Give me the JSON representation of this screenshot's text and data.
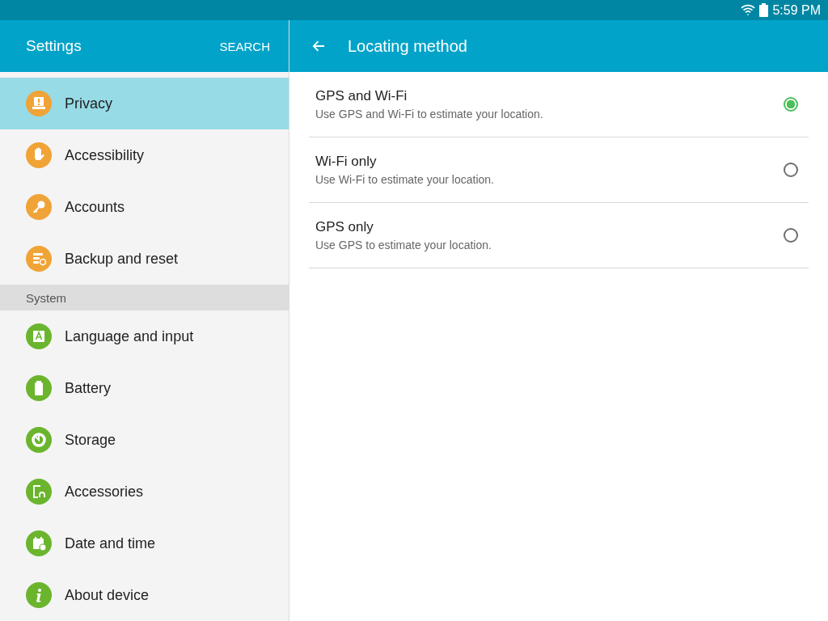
{
  "status_bar": {
    "time": "5:59 PM"
  },
  "sidebar": {
    "title": "Settings",
    "search": "SEARCH",
    "items": [
      {
        "kind": "item",
        "label": "Privacy",
        "selected": true,
        "color": "#f0a336"
      },
      {
        "kind": "item",
        "label": "Accessibility",
        "selected": false,
        "color": "#f0a336"
      },
      {
        "kind": "item",
        "label": "Accounts",
        "selected": false,
        "color": "#f0a336"
      },
      {
        "kind": "item",
        "label": "Backup and reset",
        "selected": false,
        "color": "#f0a336"
      },
      {
        "kind": "header",
        "label": "System"
      },
      {
        "kind": "item",
        "label": "Language and input",
        "selected": false,
        "color": "#6bb52e"
      },
      {
        "kind": "item",
        "label": "Battery",
        "selected": false,
        "color": "#6bb52e"
      },
      {
        "kind": "item",
        "label": "Storage",
        "selected": false,
        "color": "#6bb52e"
      },
      {
        "kind": "item",
        "label": "Accessories",
        "selected": false,
        "color": "#6bb52e"
      },
      {
        "kind": "item",
        "label": "Date and time",
        "selected": false,
        "color": "#6bb52e"
      },
      {
        "kind": "item",
        "label": "About device",
        "selected": false,
        "color": "#6bb52e"
      }
    ]
  },
  "detail": {
    "title": "Locating method",
    "options": [
      {
        "title": "GPS and Wi-Fi",
        "description": "Use GPS and Wi-Fi to estimate your location.",
        "selected": true
      },
      {
        "title": "Wi-Fi only",
        "description": "Use Wi-Fi to estimate your location.",
        "selected": false
      },
      {
        "title": "GPS only",
        "description": "Use GPS to estimate your location.",
        "selected": false
      }
    ]
  }
}
